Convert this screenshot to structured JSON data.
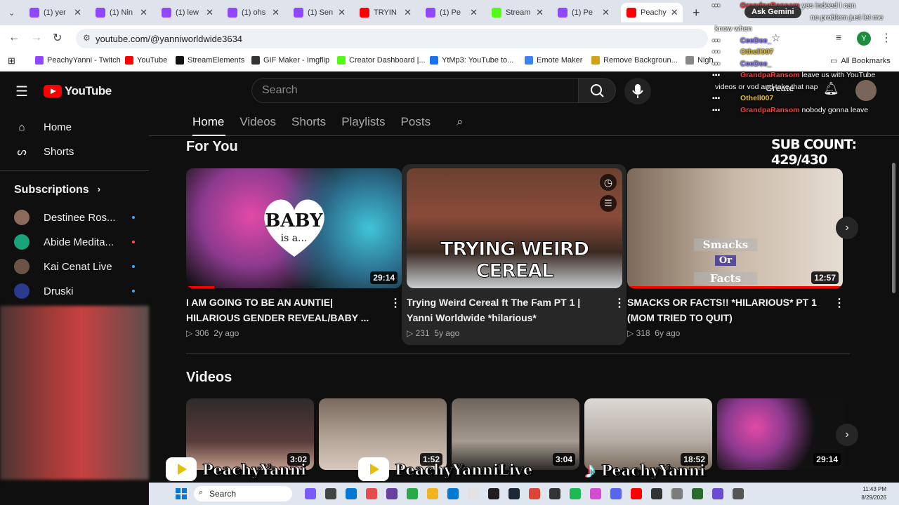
{
  "browser": {
    "tabs": [
      {
        "label": "(1) yer",
        "color": "#9146ff"
      },
      {
        "label": "(1) Nin",
        "color": "#9146ff"
      },
      {
        "label": "(1) lew",
        "color": "#9146ff"
      },
      {
        "label": "(1) ohs",
        "color": "#9146ff"
      },
      {
        "label": "(1) Sen",
        "color": "#9146ff"
      },
      {
        "label": "TRYIN",
        "color": "#ff0000"
      },
      {
        "label": "(1) Pe",
        "color": "#9146ff"
      },
      {
        "label": "Stream",
        "color": "#53fc18"
      },
      {
        "label": "(1) Pe",
        "color": "#9146ff"
      },
      {
        "label": "Peachy",
        "color": "#ff0000"
      }
    ],
    "url": "youtube.com/@yanniworldwide3634",
    "profile_initial": "Y",
    "bookmarks": [
      {
        "label": "PeachyYanni - Twitch",
        "color": "#9146ff"
      },
      {
        "label": "YouTube",
        "color": "#ff0000"
      },
      {
        "label": "StreamElements",
        "color": "#111111"
      },
      {
        "label": "GIF Maker - Imgflip",
        "color": "#333333"
      },
      {
        "label": "Creator Dashboard |...",
        "color": "#53fc18"
      },
      {
        "label": "YtMp3: YouTube to...",
        "color": "#1a73e8"
      },
      {
        "label": "Emote Maker",
        "color": "#3b82f6"
      },
      {
        "label": "Remove Backgroun...",
        "color": "#d4a017"
      },
      {
        "label": "Nigh",
        "color": "#888888"
      }
    ],
    "all_bookmarks": "All Bookmarks",
    "ask_gemini": "Ask Gemini"
  },
  "youtube": {
    "logo_text": "YouTube",
    "search_placeholder": "Search",
    "create_label": "Create",
    "sidebar": {
      "home": "Home",
      "shorts": "Shorts",
      "subscriptions_title": "Subscriptions",
      "subscriptions": [
        {
          "name": "Destinee Ros...",
          "color": "#8a6a5a"
        },
        {
          "name": "Abide Medita...",
          "color": "#1aa37a"
        },
        {
          "name": "Kai Cenat Live",
          "color": "#6b5445"
        },
        {
          "name": "Druski",
          "color": "#2a3b8f"
        }
      ]
    },
    "nav_tabs": [
      "Home",
      "Videos",
      "Shorts",
      "Playlists",
      "Posts"
    ],
    "for_you": {
      "title": "For You",
      "videos": [
        {
          "title_line1": "I AM GOING TO BE AN AUNTIE|",
          "title_line2": "HILARIOUS GENDER REVEAL/BABY ...",
          "views": "306",
          "age": "2y ago",
          "duration": "29:14",
          "thumb_text1": "BABY",
          "thumb_text2": "is a..."
        },
        {
          "title_line1": "Trying Weird Cereal ft The Fam PT 1 |",
          "title_line2": "Yanni Worldwide *hilarious*",
          "views": "231",
          "age": "5y ago",
          "duration": "",
          "thumb_text1": "TRYING WEIRD CEREAL",
          "thumb_text2": ""
        },
        {
          "title_line1": "SMACKS OR FACTS!! *HILARIOUS* PT 1",
          "title_line2": "(MOM TRIED TO QUIT)",
          "views": "318",
          "age": "6y ago",
          "duration": "12:57",
          "thumb_text1": "Smacks",
          "thumb_text2": "Or",
          "thumb_text3": "Facts"
        }
      ]
    },
    "videos_section": {
      "title": "Videos",
      "durations": [
        "3:02",
        "1:52",
        "3:04",
        "18:52",
        "29:14"
      ]
    }
  },
  "stream": {
    "sub_count": "SUB COUNT: 429/430",
    "chat": [
      {
        "name": "GrandpaRansom",
        "color": "#ff3b3b",
        "text": "yes indeed I can"
      },
      {
        "name": "",
        "color": "#ffffff",
        "text": "no problem just let me"
      },
      {
        "name": "",
        "color": "#ffffff",
        "text": "know when"
      },
      {
        "name": "CeeDee_",
        "color": "#8a7dff",
        "text": ""
      },
      {
        "name": "Othell007",
        "color": "#e0c13a",
        "text": ""
      },
      {
        "name": "CeeDee_",
        "color": "#8a7dff",
        "text": ""
      },
      {
        "name": "GrandpaRansom",
        "color": "#ff3b3b",
        "text": "leave us with YouTube"
      },
      {
        "name": "",
        "color": "#ffffff",
        "text": "videos or vod and take that nap"
      },
      {
        "name": "Othell007",
        "color": "#e0c13a",
        "text": ""
      },
      {
        "name": "GrandpaRansom",
        "color": "#ff3b3b",
        "text": "nobody gonna leave"
      }
    ],
    "brands": [
      "PeachyYanni",
      "PeachyYanniLive",
      "PeachyYanni"
    ]
  },
  "taskbar": {
    "search": "Search",
    "time": "11:43 PM",
    "date": "8/29/2026"
  }
}
